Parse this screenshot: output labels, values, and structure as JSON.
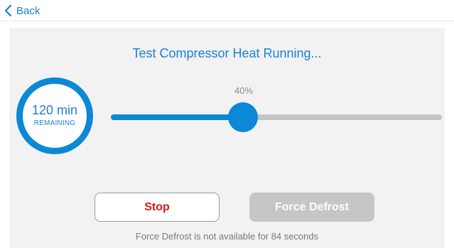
{
  "nav": {
    "back_label": "Back"
  },
  "test": {
    "title": "Test Compressor Heat Running...",
    "timer_value": "120 min",
    "timer_caption": "REMAINING",
    "progress_label": "40%",
    "progress_fraction": 0.4
  },
  "actions": {
    "stop_label": "Stop",
    "force_defrost_label": "Force Defrost",
    "force_defrost_enabled": false,
    "note": "Force Defrost is not available for 84 seconds"
  },
  "icons": {
    "back": "chevron-left-icon"
  },
  "colors": {
    "accent": "#0b88d6",
    "stop": "#d01818",
    "disabled": "#c6c6c6"
  }
}
